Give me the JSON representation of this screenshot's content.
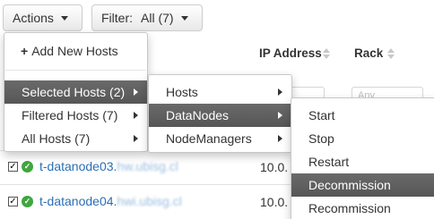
{
  "toolbar": {
    "actions_label": "Actions",
    "filter_label": "Filter:",
    "filter_value": "All (7)"
  },
  "table": {
    "columns": {
      "ip_address": "IP Address",
      "rack": "Rack"
    },
    "rack_filter_placeholder": "Any",
    "rows": [
      {
        "host": "t-datanode03.",
        "host_blurred": "hw.ubisg.cl",
        "ip": "10.0."
      },
      {
        "host": "t-datanode04.",
        "host_blurred": "hwi.ubisg.cl",
        "ip": "10.0."
      }
    ]
  },
  "actions_menu": {
    "add_new_hosts": "Add New Hosts",
    "items": [
      {
        "label": "Selected Hosts (2)"
      },
      {
        "label": "Filtered Hosts (7)"
      },
      {
        "label": "All Hosts (7)"
      }
    ]
  },
  "hosts_submenu": {
    "items": [
      {
        "label": "Hosts"
      },
      {
        "label": "DataNodes"
      },
      {
        "label": "NodeManagers"
      }
    ]
  },
  "datanode_submenu": {
    "items": [
      {
        "label": "Start"
      },
      {
        "label": "Stop"
      },
      {
        "label": "Restart"
      },
      {
        "label": "Decommission"
      },
      {
        "label": "Recommission"
      }
    ]
  },
  "colors": {
    "link": "#2a6fb4",
    "active_menu_bg": "#5f5f5f",
    "status_ok": "#3fa63f"
  }
}
